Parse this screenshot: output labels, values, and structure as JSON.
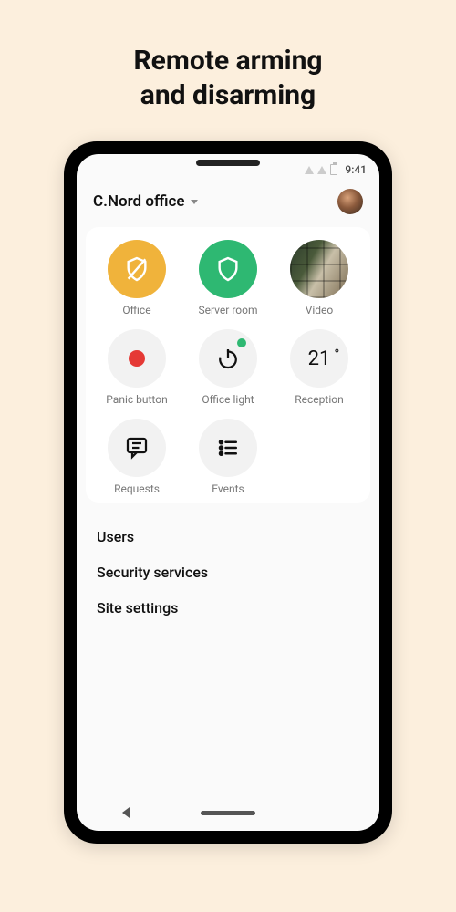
{
  "page": {
    "title_line1": "Remote arming",
    "title_line2": "and disarming"
  },
  "status": {
    "time": "9:41"
  },
  "header": {
    "site_name": "C.Nord office"
  },
  "tiles": [
    {
      "label": "Office"
    },
    {
      "label": "Server room"
    },
    {
      "label": "Video"
    },
    {
      "label": "Panic button"
    },
    {
      "label": "Office light"
    },
    {
      "label": "Reception",
      "value": "21"
    },
    {
      "label": "Requests"
    },
    {
      "label": "Events"
    }
  ],
  "menu": [
    {
      "label": "Users"
    },
    {
      "label": "Security services"
    },
    {
      "label": "Site settings"
    }
  ]
}
